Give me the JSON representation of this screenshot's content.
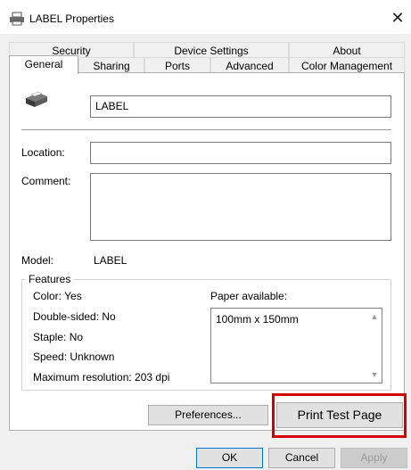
{
  "window": {
    "title": "LABEL Properties",
    "icon": "printer-icon",
    "close_glyph": "✕"
  },
  "tabs": {
    "row_back": [
      "Security",
      "Device Settings",
      "About"
    ],
    "row_front": [
      "General",
      "Sharing",
      "Ports",
      "Advanced",
      "Color Management"
    ],
    "active": "General"
  },
  "general": {
    "printer_name": "LABEL",
    "location_label": "Location:",
    "location_value": "",
    "comment_label": "Comment:",
    "comment_value": "",
    "model_label": "Model:",
    "model_value": "LABEL"
  },
  "features": {
    "legend": "Features",
    "color": "Color: Yes",
    "double_sided": "Double-sided: No",
    "staple": "Staple: No",
    "speed": "Speed: Unknown",
    "max_resolution": "Maximum resolution: 203 dpi",
    "paper_label": "Paper available:",
    "paper_items": [
      "100mm x 150mm"
    ]
  },
  "buttons": {
    "preferences": "Preferences...",
    "print_test_page": "Print Test Page",
    "ok": "OK",
    "cancel": "Cancel",
    "apply": "Apply"
  },
  "colors": {
    "highlight": "#d40000",
    "accent": "#0078d7"
  }
}
